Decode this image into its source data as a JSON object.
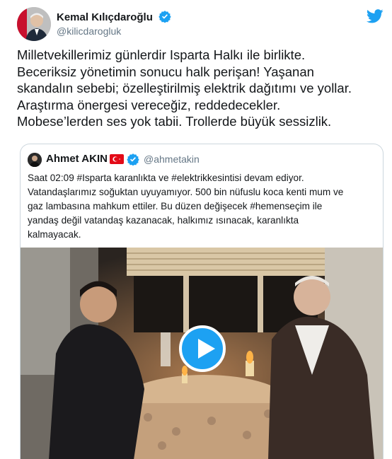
{
  "tweet": {
    "author_name": "Kemal Kılıçdaroğlu",
    "handle": "@kilicdarogluk",
    "verified": true,
    "text_lines": [
      "Milletvekillerimiz günlerdir Isparta Halkı ile birlikte.",
      "Beceriksiz yönetimin sonucu halk perişan! Yaşanan",
      "skandalın sebebi; özelleştirilmiş elektrik dağıtımı ve yollar.",
      "Araştırma önergesi vereceğiz, reddedecekler.",
      "Mobese’lerden ses yok tabii. Trollerde büyük sessizlik."
    ]
  },
  "quoted_tweet": {
    "author_name": "Ahmet AKIN",
    "handle": "@ahmetakin",
    "verified": true,
    "flag": "turkey-flag",
    "text_lines": [
      "Saat 02:09 #Isparta karanlıkta ve #elektrikkesintisi devam ediyor.",
      "Vatandaşlarımız soğuktan uyuyamıyor. 500 bin nüfuslu koca kenti mum ve",
      "gaz lambasına mahkum ettiler. Bu düzen değişecek #hemenseçim ile",
      "yandaş değil vatandaş kazanacak, halkımız ısınacak, karanlıkta",
      "kalmayacak."
    ],
    "media": {
      "type": "video",
      "icon": "play-icon"
    }
  },
  "colors": {
    "accent": "#1da1f2",
    "text": "#14171a",
    "secondary_text": "#657786",
    "border": "#ccd6dd"
  },
  "icons": {
    "brand": "twitter-bird-icon",
    "verified": "verified-badge-icon"
  }
}
